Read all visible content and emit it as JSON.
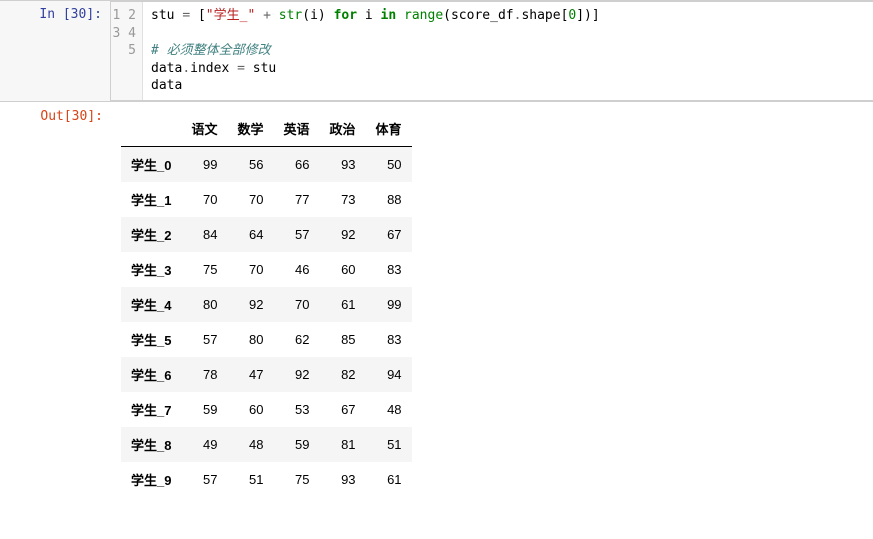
{
  "in_prompt": "In [30]:",
  "out_prompt": "Out[30]:",
  "gutter": [
    "1",
    "2",
    "3",
    "4",
    "5"
  ],
  "code": {
    "l1a": "stu ",
    "l1eq": "=",
    "l1b": " [",
    "l1str": "\"学生_\"",
    "l1c": " ",
    "l1plus": "+",
    "l1d": " ",
    "l1strfn": "str",
    "l1e": "(i) ",
    "l1for": "for",
    "l1f": " i ",
    "l1in": "in",
    "l1g": " ",
    "l1range": "range",
    "l1h": "(score_df",
    "l1dot1": ".",
    "l1i": "shape[",
    "l1zero": "0",
    "l1j": "])]",
    "l3": "# 必须整体全部修改",
    "l4a": "data",
    "l4dot": ".",
    "l4b": "index ",
    "l4eq": "=",
    "l4c": " stu",
    "l5": "data"
  },
  "table": {
    "columns": [
      "语文",
      "数学",
      "英语",
      "政治",
      "体育"
    ],
    "index": [
      "学生_0",
      "学生_1",
      "学生_2",
      "学生_3",
      "学生_4",
      "学生_5",
      "学生_6",
      "学生_7",
      "学生_8",
      "学生_9"
    ],
    "rows": [
      [
        99,
        56,
        66,
        93,
        50
      ],
      [
        70,
        70,
        77,
        73,
        88
      ],
      [
        84,
        64,
        57,
        92,
        67
      ],
      [
        75,
        70,
        46,
        60,
        83
      ],
      [
        80,
        92,
        70,
        61,
        99
      ],
      [
        57,
        80,
        62,
        85,
        83
      ],
      [
        78,
        47,
        92,
        82,
        94
      ],
      [
        59,
        60,
        53,
        67,
        48
      ],
      [
        49,
        48,
        59,
        81,
        51
      ],
      [
        57,
        51,
        75,
        93,
        61
      ]
    ]
  },
  "chart_data": {
    "type": "table",
    "columns": [
      "语文",
      "数学",
      "英语",
      "政治",
      "体育"
    ],
    "index": [
      "学生_0",
      "学生_1",
      "学生_2",
      "学生_3",
      "学生_4",
      "学生_5",
      "学生_6",
      "学生_7",
      "学生_8",
      "学生_9"
    ],
    "rows": [
      [
        99,
        56,
        66,
        93,
        50
      ],
      [
        70,
        70,
        77,
        73,
        88
      ],
      [
        84,
        64,
        57,
        92,
        67
      ],
      [
        75,
        70,
        46,
        60,
        83
      ],
      [
        80,
        92,
        70,
        61,
        99
      ],
      [
        57,
        80,
        62,
        85,
        83
      ],
      [
        78,
        47,
        92,
        82,
        94
      ],
      [
        59,
        60,
        53,
        67,
        48
      ],
      [
        49,
        48,
        59,
        81,
        51
      ],
      [
        57,
        51,
        75,
        93,
        61
      ]
    ]
  }
}
